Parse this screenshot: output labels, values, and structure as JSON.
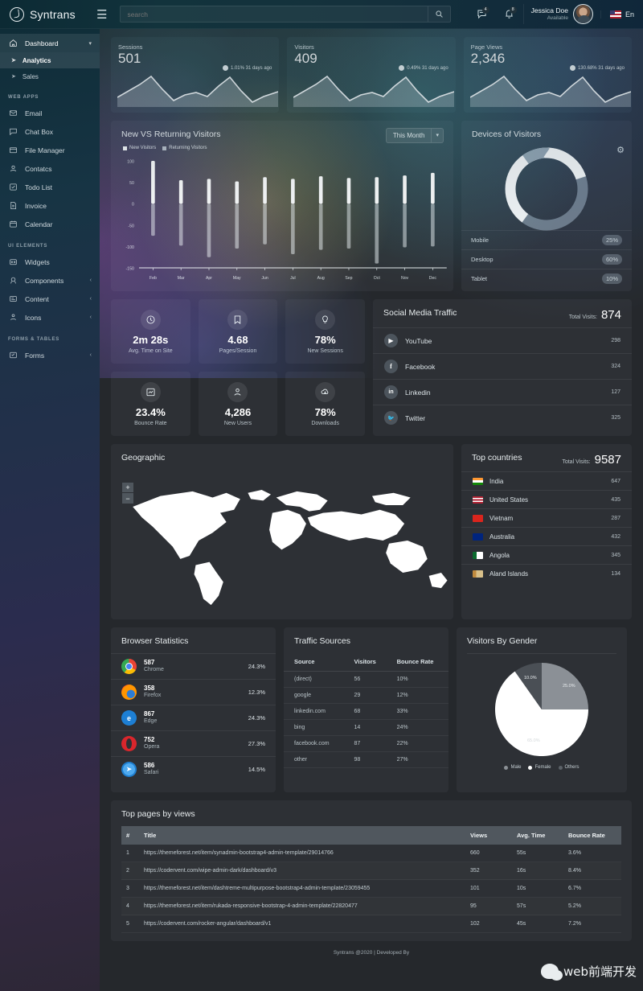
{
  "header": {
    "brand": "Syntrans",
    "menu_icon": "hamburger-icon",
    "search_placeholder": "search",
    "search_value": "",
    "search_icon": "search-icon",
    "messages_icon": "message-icon",
    "messages_badge": "4",
    "notifications_icon": "bell-icon",
    "notifications_badge": "8",
    "user_name": "Jessica Doe",
    "user_status": "Available",
    "language": "En"
  },
  "sidebar": {
    "items": [
      {
        "label": "Dashboard",
        "icon": "home-icon",
        "active": true,
        "chevron": "chevron-down-icon"
      }
    ],
    "sub_items": [
      {
        "label": "Analytics",
        "active": true
      },
      {
        "label": "Sales",
        "active": false
      }
    ],
    "section_web_apps": "WEB APPS",
    "web_apps": [
      {
        "label": "Email",
        "icon": "envelope-icon"
      },
      {
        "label": "Chat Box",
        "icon": "chat-icon"
      },
      {
        "label": "File Manager",
        "icon": "folder-icon"
      },
      {
        "label": "Contatcs",
        "icon": "contacts-icon"
      },
      {
        "label": "Todo List",
        "icon": "checklist-icon"
      },
      {
        "label": "Invoice",
        "icon": "document-icon"
      },
      {
        "label": "Calendar",
        "icon": "calendar-icon"
      }
    ],
    "section_ui_elements": "UI ELEMENTS",
    "ui_elements": [
      {
        "label": "Widgets",
        "icon": "widget-icon",
        "chevron": ""
      },
      {
        "label": "Components",
        "icon": "components-icon",
        "chevron": "chevron-right-icon"
      },
      {
        "label": "Content",
        "icon": "content-icon",
        "chevron": "chevron-right-icon"
      },
      {
        "label": "Icons",
        "icon": "icons-icon",
        "chevron": "chevron-right-icon"
      }
    ],
    "section_forms_tables": "FORMS & TABLES",
    "forms_tables": [
      {
        "label": "Forms",
        "icon": "form-icon",
        "chevron": "chevron-right-icon"
      }
    ]
  },
  "stats": [
    {
      "label": "Sessions",
      "value": "501",
      "delta": "1.01% 31 days ago"
    },
    {
      "label": "Visitors",
      "value": "409",
      "delta": "0.49% 31 days ago"
    },
    {
      "label": "Page Views",
      "value": "2,346",
      "delta": "130.68% 31 days ago"
    }
  ],
  "visitors_chart": {
    "title": "New VS Returning Visitors",
    "period": "This Month",
    "period_caret": "chevron-down-icon"
  },
  "devices": {
    "title": "Devices of Visitors",
    "settings_icon": "gear-icon",
    "rows": [
      {
        "label": "Mobile",
        "pct": "25%"
      },
      {
        "label": "Desktop",
        "pct": "60%"
      },
      {
        "label": "Tablet",
        "pct": "10%"
      }
    ]
  },
  "tiles": [
    {
      "value": "2m 28s",
      "label": "Avg. Time on Site",
      "icon": "clock-icon"
    },
    {
      "value": "4.68",
      "label": "Pages/Session",
      "icon": "bookmark-icon"
    },
    {
      "value": "78%",
      "label": "New Sessions",
      "icon": "bulb-icon"
    },
    {
      "value": "23.4%",
      "label": "Bounce Rate",
      "icon": "chart-icon"
    },
    {
      "value": "4,286",
      "label": "New Users",
      "icon": "users-icon"
    },
    {
      "value": "78%",
      "label": "Downloads",
      "icon": "cloud-download-icon"
    }
  ],
  "social": {
    "title": "Social Media Traffic",
    "total_label": "Total Visits:",
    "total_value": "874",
    "rows": [
      {
        "name": "YouTube",
        "value": "298",
        "icon": "youtube-icon"
      },
      {
        "name": "Facebook",
        "value": "324",
        "icon": "facebook-icon"
      },
      {
        "name": "Linkedin",
        "value": "127",
        "icon": "linkedin-icon"
      },
      {
        "name": "Twitter",
        "value": "325",
        "icon": "twitter-icon"
      }
    ]
  },
  "geographic": {
    "title": "Geographic",
    "zoom_in": "+",
    "zoom_out": "−"
  },
  "countries": {
    "title": "Top countries",
    "total_label": "Total Visits:",
    "total_value": "9587",
    "rows": [
      {
        "name": "India",
        "value": "647"
      },
      {
        "name": "United States",
        "value": "435"
      },
      {
        "name": "Vietnam",
        "value": "287"
      },
      {
        "name": "Australia",
        "value": "432"
      },
      {
        "name": "Angola",
        "value": "345"
      },
      {
        "name": "Aland Islands",
        "value": "134"
      }
    ]
  },
  "browsers": {
    "title": "Browser Statistics",
    "rows": [
      {
        "count": "587",
        "name": "Chrome",
        "pct": "24.3%"
      },
      {
        "count": "358",
        "name": "Firefox",
        "pct": "12.3%"
      },
      {
        "count": "867",
        "name": "Edge",
        "pct": "24.3%"
      },
      {
        "count": "752",
        "name": "Opera",
        "pct": "27.3%"
      },
      {
        "count": "586",
        "name": "Safari",
        "pct": "14.5%"
      }
    ]
  },
  "traffic_sources": {
    "title": "Traffic Sources",
    "columns": [
      "Source",
      "Visitors",
      "Bounce Rate"
    ],
    "rows": [
      [
        "(direct)",
        "56",
        "10%"
      ],
      [
        "google",
        "29",
        "12%"
      ],
      [
        "linkedin.com",
        "68",
        "33%"
      ],
      [
        "bing",
        "14",
        "24%"
      ],
      [
        "facebook.com",
        "87",
        "22%"
      ],
      [
        "other",
        "98",
        "27%"
      ]
    ]
  },
  "gender": {
    "title": "Visitors By Gender",
    "legend": [
      "Male",
      "Female",
      "Others"
    ]
  },
  "top_pages": {
    "title": "Top pages by views",
    "columns": [
      "#",
      "Title",
      "Views",
      "Avg. Time",
      "Bounce Rate"
    ],
    "rows": [
      [
        "1",
        "https://themeforest.net/item/synadmin-bootstrap4-admin-template/29014766",
        "660",
        "55s",
        "3.6%"
      ],
      [
        "2",
        "https://codervent.com/wipe-admin-dark/dashboard/v3",
        "352",
        "16s",
        "8.4%"
      ],
      [
        "3",
        "https://themeforest.net/item/dashtreme-multipurpose-bootstrap4-admin-template/23059455",
        "101",
        "10s",
        "6.7%"
      ],
      [
        "4",
        "https://themeforest.net/item/rukada-responsive-bootstrap-4-admin-template/22820477",
        "95",
        "57s",
        "5.2%"
      ],
      [
        "5",
        "https://codervent.com/rocker-angular/dashboard/v1",
        "102",
        "45s",
        "7.2%"
      ]
    ]
  },
  "footer": {
    "text": "Syntrans @2020 | Developed By"
  },
  "watermark": {
    "text": "web前端开发"
  },
  "chart_data": [
    {
      "type": "bar",
      "title": "New VS Returning Visitors",
      "categories": [
        "Feb",
        "Mar",
        "Apr",
        "May",
        "Jun",
        "Jul",
        "Aug",
        "Sep",
        "Oct",
        "Nov",
        "Dec"
      ],
      "series": [
        {
          "name": "New Visitors",
          "values": [
            100,
            55,
            58,
            52,
            62,
            58,
            64,
            60,
            62,
            66,
            72
          ]
        },
        {
          "name": "Returning Visitors",
          "values": [
            -75,
            -98,
            -125,
            -105,
            -95,
            -118,
            -108,
            -105,
            -140,
            -102,
            -100
          ]
        }
      ],
      "xlabel": "",
      "ylabel": "",
      "ylim": [
        -150,
        100
      ],
      "yticks": [
        100,
        50,
        0,
        -50,
        -100,
        -150
      ],
      "grid": false,
      "legend_position": "top-left"
    },
    {
      "type": "pie",
      "title": "Devices of Visitors",
      "subtype": "donut",
      "labels": [
        "Mobile",
        "Desktop",
        "Tablet"
      ],
      "values": [
        25,
        60,
        10
      ],
      "colors": [
        "#8d98a3",
        "#6d7883",
        "#f3f6f8"
      ],
      "legend_position": "bottom"
    },
    {
      "type": "pie",
      "title": "Visitors By Gender",
      "labels": [
        "Male",
        "Female",
        "Others"
      ],
      "values": [
        25.0,
        65.0,
        10.0
      ],
      "data_labels": [
        "25.0%",
        "65.0%",
        "10.0%"
      ],
      "colors": [
        "#8b9096",
        "#ffffff",
        "#4a4f55"
      ],
      "legend_position": "bottom"
    },
    {
      "type": "area",
      "title": "Sessions",
      "x": [
        0,
        1,
        2,
        3,
        4,
        5,
        6,
        7,
        8,
        9,
        10,
        11,
        12,
        13,
        14
      ],
      "values": [
        22,
        38,
        52,
        70,
        40,
        20,
        30,
        34,
        28,
        46,
        66,
        40,
        18,
        28,
        36
      ],
      "ylabel": "",
      "xlabel": ""
    },
    {
      "type": "area",
      "title": "Visitors",
      "x": [
        0,
        1,
        2,
        3,
        4,
        5,
        6,
        7,
        8,
        9,
        10,
        11,
        12,
        13,
        14
      ],
      "values": [
        22,
        38,
        52,
        70,
        40,
        20,
        30,
        34,
        28,
        46,
        66,
        40,
        18,
        28,
        36
      ],
      "ylabel": "",
      "xlabel": ""
    },
    {
      "type": "area",
      "title": "Page Views",
      "x": [
        0,
        1,
        2,
        3,
        4,
        5,
        6,
        7,
        8,
        9,
        10,
        11,
        12,
        13,
        14
      ],
      "values": [
        22,
        38,
        52,
        70,
        40,
        20,
        30,
        34,
        28,
        46,
        66,
        40,
        18,
        28,
        36
      ],
      "ylabel": "",
      "xlabel": ""
    },
    {
      "type": "bar",
      "title": "Browser Statistics",
      "categories": [
        "Chrome",
        "Firefox",
        "Edge",
        "Opera",
        "Safari"
      ],
      "values": [
        587,
        358,
        867,
        752,
        586
      ],
      "percentages": [
        "24.3%",
        "12.3%",
        "24.3%",
        "27.3%",
        "14.5%"
      ]
    },
    {
      "type": "table",
      "title": "Traffic Sources",
      "columns": [
        "Source",
        "Visitors",
        "Bounce Rate"
      ],
      "rows": [
        [
          "(direct)",
          56,
          "10%"
        ],
        [
          "google",
          29,
          "12%"
        ],
        [
          "linkedin.com",
          68,
          "33%"
        ],
        [
          "bing",
          14,
          "24%"
        ],
        [
          "facebook.com",
          87,
          "22%"
        ],
        [
          "other",
          98,
          "27%"
        ]
      ]
    }
  ]
}
